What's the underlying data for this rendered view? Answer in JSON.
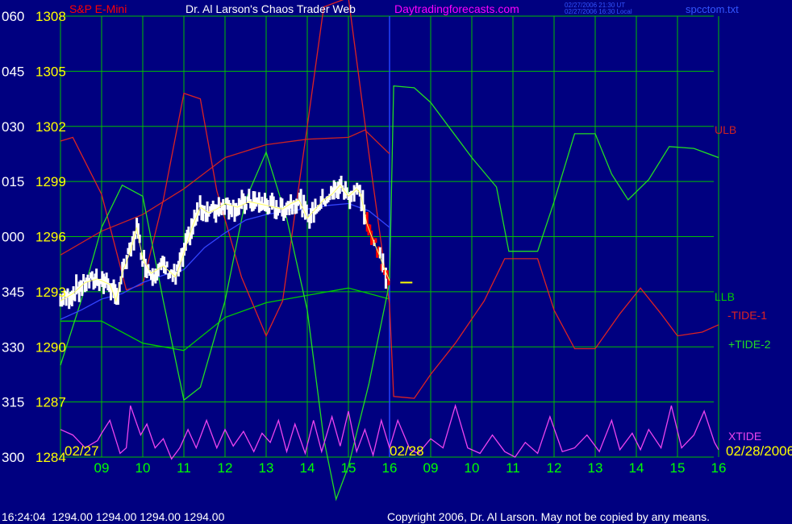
{
  "header": {
    "symbol": "S&P E-Mini",
    "title": "Dr. Al Larson's Chaos Trader Web",
    "site": "Daytradingforecasts.com",
    "stamp_ut": "02/27/2006 21:30 UT",
    "stamp_local": "02/27/2006 16:30 Local",
    "file": "spcctom.txt"
  },
  "footer": {
    "quote": "16:24:04  1294.00 1294.00 1294.00 1294.00",
    "copyright": "Copyright 2006, Dr. Al Larson. May not be copied by any means."
  },
  "colors": {
    "background": "#000080",
    "grid": "#00c000",
    "axis_left_yellow": "#ffff00",
    "axis_left_white": "#ffffff",
    "time_labels": "#00ff00",
    "header_red": "#ff0000",
    "header_white": "#ffffff",
    "header_magenta": "#ff00ff",
    "ulb_line": "#cc2222",
    "llb_line": "#00cc00",
    "tide1_line": "#dd2222",
    "tide2_line": "#22dd22",
    "xtide_line": "#ee44ee",
    "price_bars": "#ffffff",
    "price_down": "#ff0000",
    "mavg_line": "#3344ff",
    "divider": "#2244ff",
    "last_marker": "#ffff00"
  },
  "chart_data": {
    "type": "line",
    "y_left_angle_labels": [
      "060",
      "045",
      "030",
      "015",
      "000",
      "345",
      "330",
      "315",
      "300"
    ],
    "y_left_price_labels": [
      "1308",
      "1305",
      "1302",
      "1299",
      "1296",
      "1293",
      "1290",
      "1287",
      "1284"
    ],
    "ylim": [
      1284,
      1308
    ],
    "x_time_labels": [
      "09",
      "10",
      "11",
      "12",
      "13",
      "14",
      "15",
      "16",
      "09",
      "10",
      "11",
      "12",
      "13",
      "14",
      "15",
      "16"
    ],
    "date_labels": {
      "start": "02/27",
      "mid": "02/28",
      "end": "02/28/2006"
    },
    "right_labels": {
      "ulb": "ULB",
      "llb": "LLB",
      "tide1": "-TIDE-1",
      "tide2": "+TIDE-2",
      "xtide": "XTIDE"
    },
    "x_range_hours": [
      8.0,
      24.0
    ],
    "series": [
      {
        "name": "ULB",
        "points": [
          [
            8.0,
            1295.0
          ],
          [
            9.0,
            1296.3
          ],
          [
            10.0,
            1297.2
          ],
          [
            11.0,
            1298.6
          ],
          [
            12.0,
            1300.3
          ],
          [
            13.0,
            1301.0
          ],
          [
            14.0,
            1301.3
          ],
          [
            15.0,
            1301.4
          ],
          [
            15.4,
            1301.8
          ],
          [
            16.0,
            1300.5
          ]
        ]
      },
      {
        "name": "LLB",
        "points": [
          [
            8.0,
            1291.4
          ],
          [
            9.0,
            1291.4
          ],
          [
            10.0,
            1290.2
          ],
          [
            11.0,
            1289.8
          ],
          [
            12.0,
            1291.6
          ],
          [
            13.0,
            1292.4
          ],
          [
            14.0,
            1292.8
          ],
          [
            15.0,
            1293.2
          ],
          [
            16.0,
            1292.6
          ]
        ]
      },
      {
        "name": "-TIDE-1",
        "points": [
          [
            8.0,
            1301.2
          ],
          [
            8.3,
            1301.4
          ],
          [
            9.0,
            1298.3
          ],
          [
            9.6,
            1293.1
          ],
          [
            10.0,
            1293.4
          ],
          [
            10.5,
            1298.0
          ],
          [
            11.0,
            1303.8
          ],
          [
            11.4,
            1303.5
          ],
          [
            11.8,
            1298.5
          ],
          [
            12.4,
            1293.8
          ],
          [
            13.0,
            1290.6
          ],
          [
            13.4,
            1292.5
          ],
          [
            14.0,
            1302.0
          ],
          [
            14.4,
            1308.5
          ],
          [
            15.0,
            1309.0
          ],
          [
            15.5,
            1300.5
          ],
          [
            16.0,
            1292.3
          ],
          [
            16.1,
            1287.3
          ],
          [
            16.6,
            1287.2
          ],
          [
            17.0,
            1288.5
          ],
          [
            17.6,
            1290.2
          ],
          [
            18.3,
            1292.5
          ],
          [
            18.8,
            1294.8
          ],
          [
            19.6,
            1294.8
          ],
          [
            20.0,
            1292.0
          ],
          [
            20.5,
            1289.9
          ],
          [
            21.0,
            1289.9
          ],
          [
            21.6,
            1291.8
          ],
          [
            22.1,
            1293.2
          ],
          [
            22.6,
            1291.8
          ],
          [
            23.0,
            1290.6
          ],
          [
            23.6,
            1290.8
          ],
          [
            24.0,
            1291.2
          ]
        ]
      },
      {
        "name": "+TIDE-2",
        "points": [
          [
            8.0,
            1289.0
          ],
          [
            8.5,
            1292.5
          ],
          [
            9.0,
            1296.5
          ],
          [
            9.5,
            1298.8
          ],
          [
            10.0,
            1298.2
          ],
          [
            10.5,
            1292.5
          ],
          [
            11.0,
            1287.1
          ],
          [
            11.4,
            1287.8
          ],
          [
            12.0,
            1292.5
          ],
          [
            12.5,
            1298.0
          ],
          [
            13.0,
            1300.6
          ],
          [
            13.5,
            1297.0
          ],
          [
            14.0,
            1292.0
          ],
          [
            14.4,
            1285.0
          ],
          [
            14.7,
            1281.7
          ],
          [
            15.0,
            1283.5
          ],
          [
            15.5,
            1288.0
          ],
          [
            16.0,
            1293.5
          ],
          [
            16.1,
            1304.2
          ],
          [
            16.6,
            1304.1
          ],
          [
            17.0,
            1303.3
          ],
          [
            17.5,
            1301.8
          ],
          [
            18.0,
            1300.3
          ],
          [
            18.6,
            1298.7
          ],
          [
            18.9,
            1295.2
          ],
          [
            19.6,
            1295.2
          ],
          [
            20.0,
            1297.9
          ],
          [
            20.5,
            1301.6
          ],
          [
            21.0,
            1301.6
          ],
          [
            21.4,
            1299.4
          ],
          [
            21.8,
            1298.0
          ],
          [
            22.3,
            1299.1
          ],
          [
            22.8,
            1300.9
          ],
          [
            23.4,
            1300.8
          ],
          [
            24.0,
            1300.3
          ]
        ]
      },
      {
        "name": "XTIDE",
        "points": [
          [
            8.0,
            1285.5
          ],
          [
            8.3,
            1285.2
          ],
          [
            8.6,
            1284.5
          ],
          [
            8.9,
            1284.9
          ],
          [
            9.0,
            1285.3
          ],
          [
            9.2,
            1286.0
          ],
          [
            9.45,
            1284.2
          ],
          [
            9.6,
            1284.5
          ],
          [
            9.7,
            1286.8
          ],
          [
            9.95,
            1285.2
          ],
          [
            10.1,
            1285.8
          ],
          [
            10.3,
            1284.5
          ],
          [
            10.5,
            1285.0
          ],
          [
            10.7,
            1283.9
          ],
          [
            10.9,
            1284.5
          ],
          [
            11.1,
            1285.5
          ],
          [
            11.3,
            1284.5
          ],
          [
            11.55,
            1286.0
          ],
          [
            11.8,
            1284.5
          ],
          [
            12.0,
            1285.5
          ],
          [
            12.2,
            1284.6
          ],
          [
            12.45,
            1285.4
          ],
          [
            12.7,
            1284.3
          ],
          [
            12.9,
            1285.3
          ],
          [
            13.1,
            1284.8
          ],
          [
            13.3,
            1286.0
          ],
          [
            13.5,
            1284.3
          ],
          [
            13.7,
            1285.8
          ],
          [
            13.95,
            1284.2
          ],
          [
            14.15,
            1286.0
          ],
          [
            14.35,
            1284.3
          ],
          [
            14.6,
            1286.2
          ],
          [
            14.8,
            1284.6
          ],
          [
            15.0,
            1286.5
          ],
          [
            15.2,
            1284.3
          ],
          [
            15.4,
            1285.5
          ],
          [
            15.6,
            1284.1
          ],
          [
            15.8,
            1286.0
          ],
          [
            16.0,
            1284.5
          ],
          [
            16.2,
            1286.0
          ],
          [
            16.5,
            1284.4
          ],
          [
            16.7,
            1284.2
          ],
          [
            17.0,
            1285.0
          ],
          [
            17.3,
            1284.5
          ],
          [
            17.6,
            1286.8
          ],
          [
            17.9,
            1284.5
          ],
          [
            18.2,
            1284.2
          ],
          [
            18.5,
            1285.2
          ],
          [
            18.8,
            1284.3
          ],
          [
            19.05,
            1284.0
          ],
          [
            19.3,
            1284.8
          ],
          [
            19.6,
            1284.2
          ],
          [
            19.9,
            1286.2
          ],
          [
            20.2,
            1284.3
          ],
          [
            20.5,
            1284.5
          ],
          [
            20.8,
            1285.2
          ],
          [
            21.1,
            1284.3
          ],
          [
            21.4,
            1286.0
          ],
          [
            21.6,
            1284.4
          ],
          [
            21.9,
            1285.3
          ],
          [
            22.1,
            1284.4
          ],
          [
            22.3,
            1285.5
          ],
          [
            22.6,
            1284.5
          ],
          [
            22.85,
            1286.8
          ],
          [
            23.1,
            1284.5
          ],
          [
            23.4,
            1285.2
          ],
          [
            23.65,
            1286.5
          ],
          [
            23.9,
            1284.8
          ],
          [
            24.0,
            1284.4
          ]
        ]
      },
      {
        "name": "Price",
        "points": [
          [
            8.0,
            1292.5
          ],
          [
            8.3,
            1292.9
          ],
          [
            8.6,
            1293.5
          ],
          [
            8.9,
            1293.7
          ],
          [
            9.2,
            1293.4
          ],
          [
            9.35,
            1292.5
          ],
          [
            9.5,
            1294.0
          ],
          [
            9.7,
            1295.2
          ],
          [
            9.85,
            1296.5
          ],
          [
            10.0,
            1294.8
          ],
          [
            10.2,
            1294.0
          ],
          [
            10.5,
            1294.4
          ],
          [
            10.8,
            1293.8
          ],
          [
            11.0,
            1295.1
          ],
          [
            11.2,
            1296.5
          ],
          [
            11.4,
            1297.6
          ],
          [
            11.6,
            1297.3
          ],
          [
            11.8,
            1297.5
          ],
          [
            12.0,
            1297.8
          ],
          [
            12.3,
            1297.6
          ],
          [
            12.6,
            1297.9
          ],
          [
            13.0,
            1297.7
          ],
          [
            13.4,
            1297.5
          ],
          [
            13.6,
            1297.8
          ],
          [
            13.8,
            1298.0
          ],
          [
            14.0,
            1297.0
          ],
          [
            14.2,
            1297.5
          ],
          [
            14.4,
            1298.0
          ],
          [
            14.6,
            1298.3
          ],
          [
            14.8,
            1298.8
          ],
          [
            15.0,
            1298.2
          ],
          [
            15.2,
            1298.6
          ],
          [
            15.3,
            1298.3
          ],
          [
            15.45,
            1296.7
          ],
          [
            15.6,
            1295.8
          ],
          [
            15.75,
            1295.0
          ],
          [
            15.85,
            1294.4
          ],
          [
            16.0,
            1293.6
          ]
        ]
      },
      {
        "name": "Moving Average",
        "points": [
          [
            8.0,
            1291.5
          ],
          [
            8.5,
            1292.0
          ],
          [
            9.0,
            1292.6
          ],
          [
            9.5,
            1292.9
          ],
          [
            10.0,
            1293.5
          ],
          [
            10.5,
            1293.9
          ],
          [
            11.0,
            1294.2
          ],
          [
            11.5,
            1295.4
          ],
          [
            12.0,
            1296.2
          ],
          [
            12.5,
            1296.9
          ],
          [
            13.0,
            1297.2
          ],
          [
            13.5,
            1297.4
          ],
          [
            14.0,
            1297.5
          ],
          [
            14.5,
            1297.7
          ],
          [
            15.0,
            1297.8
          ],
          [
            15.5,
            1297.4
          ],
          [
            16.0,
            1296.5
          ]
        ]
      }
    ],
    "last_price_marker": {
      "x": 16.3,
      "y": 1293.5
    }
  }
}
